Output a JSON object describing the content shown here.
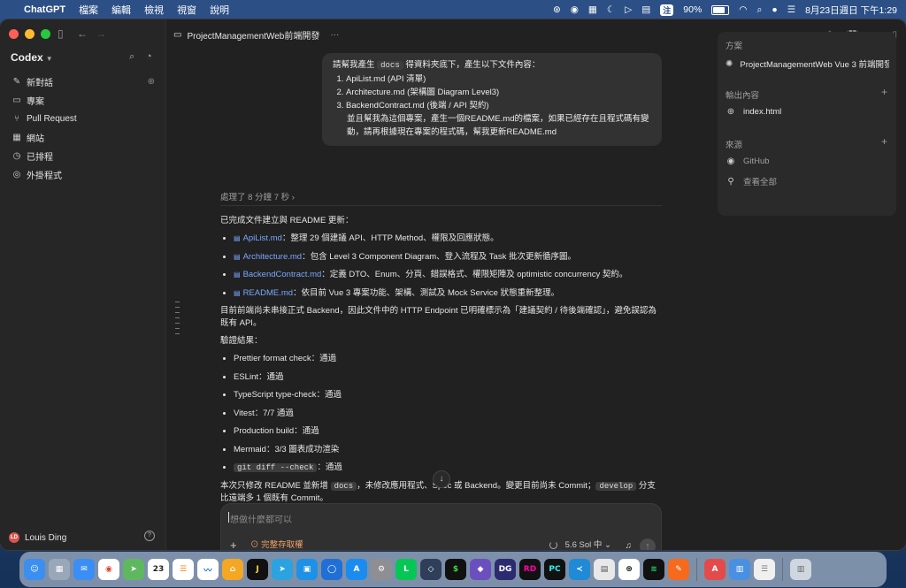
{
  "menubar": {
    "app_name": "ChatGPT",
    "menus": [
      "檔案",
      "編輯",
      "檢視",
      "視窗",
      "說明"
    ],
    "input_method": "注",
    "battery": "90%",
    "datetime": "8月23日週日 下午1:29"
  },
  "sidebar": {
    "title": "Codex",
    "items": [
      {
        "icon": "compose-icon",
        "label": "新對話"
      },
      {
        "icon": "folder-icon",
        "label": "專案"
      },
      {
        "icon": "pull-request-icon",
        "label": "Pull Request"
      },
      {
        "icon": "grid-icon",
        "label": "網站"
      },
      {
        "icon": "clock-icon",
        "label": "已排程"
      },
      {
        "icon": "plugin-icon",
        "label": "外掛程式"
      }
    ],
    "user": {
      "initials": "LD",
      "name": "Louis Ding"
    }
  },
  "topbar": {
    "project": "ProjectManagementWeb前端開發",
    "more": "···"
  },
  "chat": {
    "user_message": {
      "intro_prefix": "請幫我產生 ",
      "intro_code": "docs",
      "intro_suffix": " 得資料夾底下，產生以下文件內容：",
      "items": [
        "ApiList.md (API 清單)",
        "Architecture.md (架構圖 Diagram Level3)",
        "BackendContract.md (後端 / API 契約)"
      ],
      "tail": "並且幫我為這個專案，產生一個README.md的檔案，如果已經存在且程式碼有變動，請再根據現在專案的程式碼，幫我更新README.md"
    },
    "processed": "處理了 8 分鐘 7 秒",
    "response": {
      "intro": "已完成文件建立與 README 更新：",
      "files": [
        {
          "name": "ApiList.md",
          "desc": "：整理 29 個建議 API、HTTP Method、權限及回應狀態。"
        },
        {
          "name": "Architecture.md",
          "desc": "：包含 Level 3 Component Diagram、登入流程及 Task 批次更新循序圖。"
        },
        {
          "name": "BackendContract.md",
          "desc": "：定義 DTO、Enum、分頁、錯誤格式、權限矩陣及 optimistic concurrency 契約。"
        },
        {
          "name": "README.md",
          "desc": "：依目前 Vue 3 專案功能、架構、測試及 Mock Service 狀態重新整理。"
        }
      ],
      "note": "目前前端尚未串接正式 Backend，因此文件中的 HTTP Endpoint 已明確標示為「建議契約 / 待後端確認」，避免誤認為既有 API。",
      "verify_title": "驗證結果：",
      "checks": [
        "Prettier format check：通過",
        "ESLint：通過",
        "TypeScript type-check：通過",
        "Vitest：7/7 通過",
        "Production build：通過",
        "Mermaid：3/3 圖表成功渲染"
      ],
      "last_check_code": "git diff --check",
      "last_check_result": "：通過",
      "footer_a": "本次只修改 README 並新增 ",
      "footer_code1": "docs",
      "footer_b": "，未修改應用程式、Spec 或 Backend。變更目前尚未 Commit；",
      "footer_code2": "develop",
      "footer_c": " 分支比遠端多 1 個既有 Commit。"
    },
    "composer": {
      "placeholder": "想做什麼都可以",
      "access": "完整存取權",
      "model": "5.6 Sol 中"
    }
  },
  "panel": {
    "plan_title": "方案",
    "plan_item": "ProjectManagementWeb Vue 3 前端開發",
    "output_title": "輸出內容",
    "output_item": "index.html",
    "source_title": "來源",
    "source_item": "GitHub",
    "view_all": "查看全部"
  },
  "dock": {
    "calendar_day": "23",
    "apps": [
      "finder-icon",
      "launchpad-icon",
      "mail-icon",
      "chrome-icon",
      "maps-icon",
      "calendar-icon",
      "reminders-icon",
      "freeform-icon",
      "home-icon",
      "jetbrains-icon",
      "telegram-icon",
      "docker-icon",
      "webex-icon",
      "app-store-icon",
      "system-settings-icon",
      "line-icon",
      "dev-icon",
      "terminal-icon",
      "obsidian-icon",
      "datagrip-icon",
      "rider-icon",
      "pycharm-icon",
      "vscode-icon",
      "preview-icon",
      "chatgpt-icon",
      "spotify-icon",
      "pages-icon",
      "acrobat-icon",
      "archive-icon",
      "notes-icon",
      "trash-icon"
    ]
  }
}
